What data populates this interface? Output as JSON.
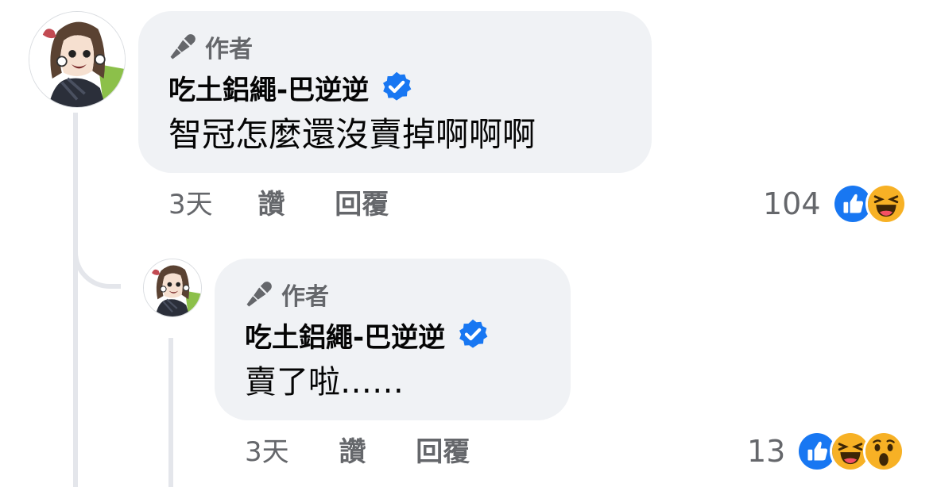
{
  "comments": [
    {
      "author_badge": "作者",
      "author_name": "吃土鋁繩-巴逆逆",
      "text": "智冠怎麼還沒賣掉啊啊啊",
      "time": "3天",
      "like_label": "讚",
      "reply_label": "回覆",
      "reaction_count": "104",
      "reactions": [
        "like-icon",
        "haha-icon"
      ]
    },
    {
      "author_badge": "作者",
      "author_name": "吃土鋁繩-巴逆逆",
      "text": "賣了啦……",
      "time": "3天",
      "like_label": "讚",
      "reply_label": "回覆",
      "reaction_count": "13",
      "reactions": [
        "like-icon",
        "haha-icon",
        "wow-icon"
      ]
    }
  ],
  "colors": {
    "bubble": "#f0f2f5",
    "verified": "#1877f2",
    "like": "#1877f2",
    "haha": "#f7b125",
    "secondary_text": "#65676b",
    "thread_line": "#e4e6eb"
  }
}
